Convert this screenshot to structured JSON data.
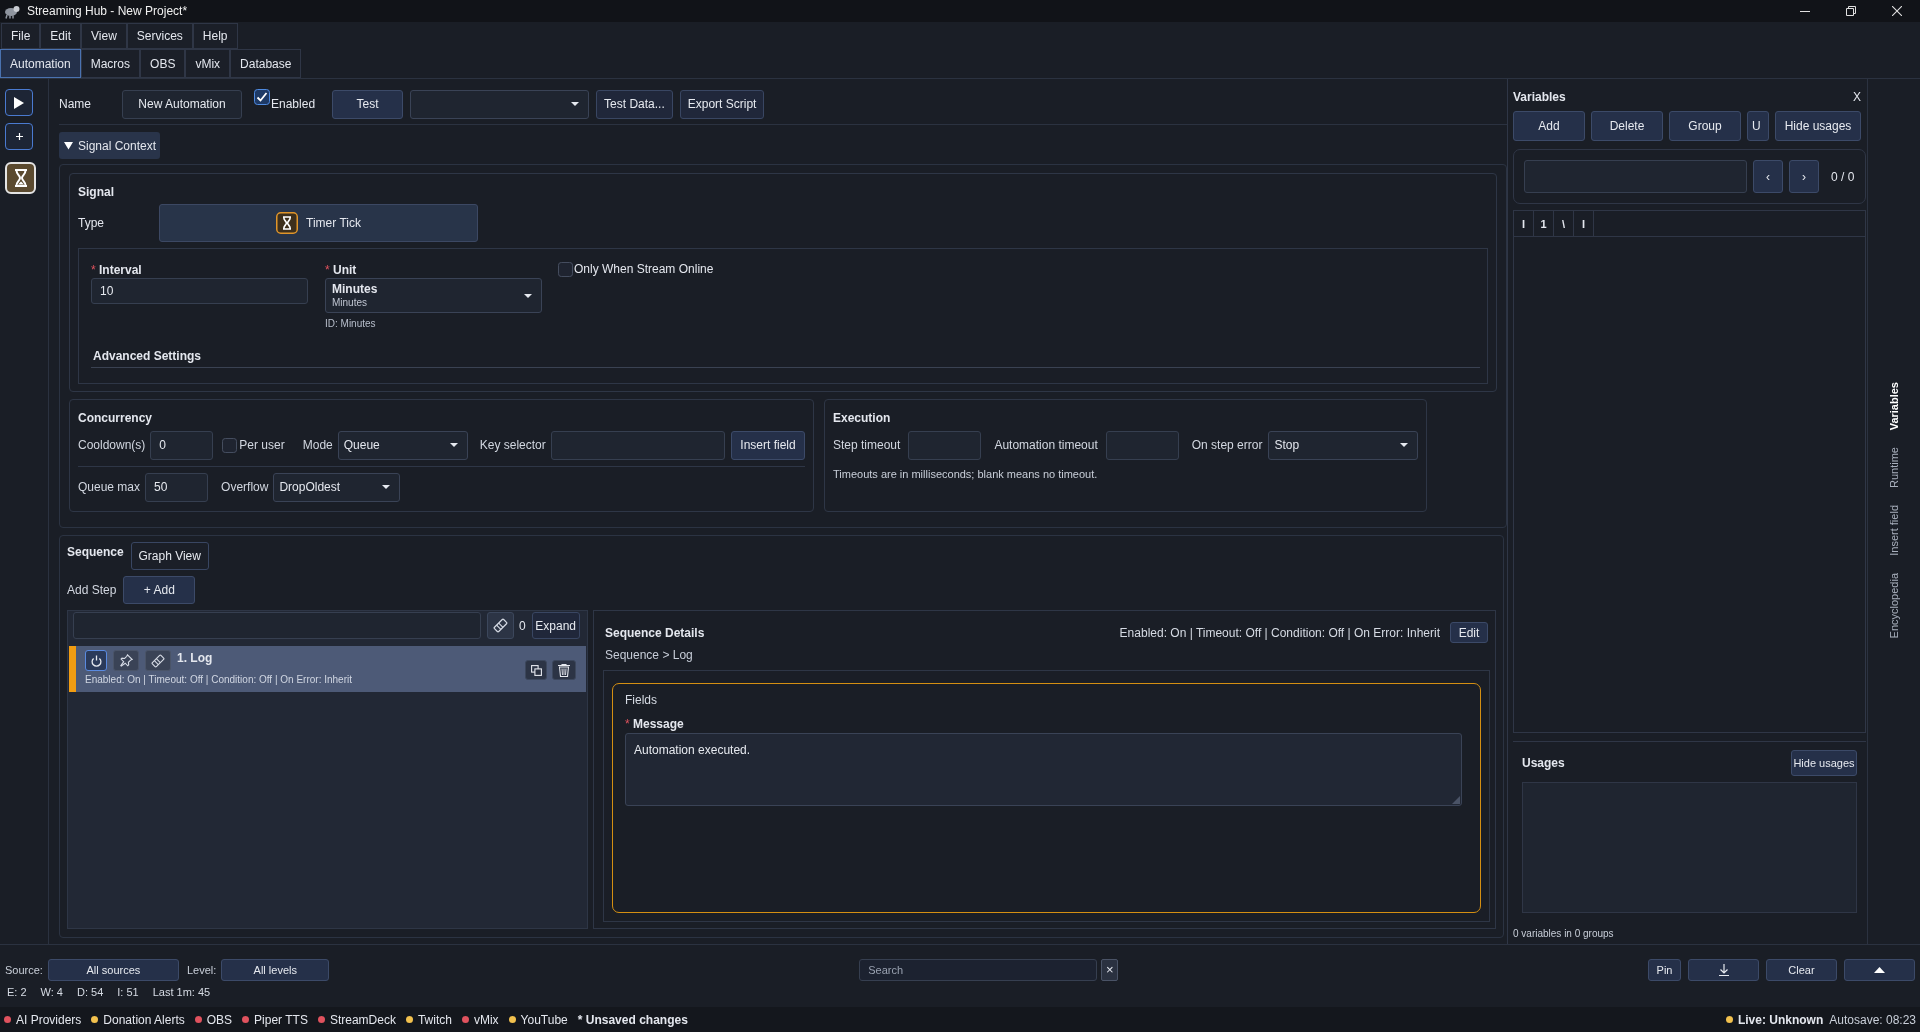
{
  "window": {
    "title": "Streaming Hub - New Project*"
  },
  "menu": [
    {
      "label": "File"
    },
    {
      "label": "Edit"
    },
    {
      "label": "View"
    },
    {
      "label": "Services"
    },
    {
      "label": "Help"
    }
  ],
  "tabs": [
    {
      "label": "Automation",
      "selected": true
    },
    {
      "label": "Macros",
      "selected": false
    },
    {
      "label": "OBS",
      "selected": false
    },
    {
      "label": "vMix",
      "selected": false
    },
    {
      "label": "Database",
      "selected": false
    }
  ],
  "side_toolbar": [
    {
      "kind": "play",
      "selected": false
    },
    {
      "kind": "add",
      "selected": false
    },
    {
      "kind": "timer",
      "selected": true
    }
  ],
  "toolbar": {
    "name_label": "Name",
    "name_value": "New Automation",
    "enabled_label": "Enabled",
    "enabled_checked": true,
    "test_button": "Test",
    "buttons": [
      {
        "label": "Test Data..."
      },
      {
        "label": "Export Script"
      }
    ]
  },
  "signal_context": {
    "label": "Signal Context",
    "expanded": true
  },
  "signal": {
    "title": "Signal",
    "type_label": "Type",
    "type_value": "Timer Tick",
    "interval": {
      "required_mark": "*",
      "label": "Interval",
      "value": "10"
    },
    "unit": {
      "required_mark": "*",
      "label": "Unit",
      "value": "Minutes",
      "detail": "Minutes",
      "id_note": "ID: Minutes"
    },
    "online_only": {
      "label": "Only When Stream Online",
      "checked": false
    },
    "advanced": "Advanced Settings"
  },
  "concurrency": {
    "title": "Concurrency",
    "cooldown_label": "Cooldown(s)",
    "cooldown": "0",
    "per_user": {
      "label": "Per user",
      "checked": false
    },
    "mode_label": "Mode",
    "mode": "Queue",
    "key_selector_label": "Key selector",
    "insert_field": "Insert field",
    "queue_max_label": "Queue max",
    "queue_max": "50",
    "overflow_label": "Overflow",
    "overflow": "DropOldest"
  },
  "execution": {
    "title": "Execution",
    "step_timeout_label": "Step timeout",
    "automation_timeout_label": "Automation timeout",
    "on_step_error_label": "On step error",
    "on_step_error": "Stop",
    "note": "Timeouts are in milliseconds; blank means no timeout."
  },
  "sequence": {
    "title": "Sequence",
    "graph_view": "Graph View",
    "add_step_label": "Add Step",
    "add_button": "+ Add",
    "step_count": "0",
    "expand": "Expand",
    "steps": [
      {
        "title": "1. Log",
        "summary": "Enabled: On | Timeout: Off | Condition: Off | On Error: Inherit",
        "selected": true,
        "enabled": true
      }
    ],
    "details": {
      "title": "Sequence Details",
      "summary": "Enabled: On | Timeout: Off | Condition: Off | On Error: Inherit",
      "edit": "Edit",
      "breadcrumb": "Sequence > Log",
      "fields_title": "Fields",
      "message": {
        "required_mark": "*",
        "label": "Message",
        "value": "Automation executed."
      }
    }
  },
  "variables": {
    "title": "Variables",
    "close": "X",
    "buttons": [
      {
        "label": "Add"
      },
      {
        "label": "Delete"
      },
      {
        "label": "Group"
      },
      {
        "label": "U"
      },
      {
        "label": "Hide usages"
      }
    ],
    "prev": "‹",
    "next": "›",
    "count": "0 / 0",
    "columns": [
      "I",
      "1",
      "\\",
      "I"
    ],
    "usages_title": "Usages",
    "usages_button": "Hide usages",
    "summary": "0 variables in 0 groups"
  },
  "side_tabs": [
    {
      "label": "Variables",
      "selected": true
    },
    {
      "label": "Runtime",
      "selected": false
    },
    {
      "label": "Insert field",
      "selected": false
    },
    {
      "label": "Encyclopedia",
      "selected": false
    }
  ],
  "log_bar": {
    "source_label": "Source:",
    "source": "All sources",
    "level_label": "Level:",
    "level": "All levels",
    "search_placeholder": "Search",
    "clear_search": "×",
    "pin": "Pin",
    "clear": "Clear",
    "stats": [
      "E: 2",
      "W: 4",
      "D: 54",
      "I: 51",
      "Last 1m: 45"
    ]
  },
  "status_bar": {
    "services": [
      {
        "name": "AI Providers",
        "color": "#e0525e"
      },
      {
        "name": "Donation Alerts",
        "color": "#f2c14e"
      },
      {
        "name": "OBS",
        "color": "#e0525e"
      },
      {
        "name": "Piper TTS",
        "color": "#e0525e"
      },
      {
        "name": "StreamDeck",
        "color": "#e0525e"
      },
      {
        "name": "Twitch",
        "color": "#f2c14e"
      },
      {
        "name": "vMix",
        "color": "#e0525e"
      },
      {
        "name": "YouTube",
        "color": "#f2c14e"
      }
    ],
    "unsaved": "* Unsaved changes",
    "live": {
      "label": "Live: Unknown",
      "color": "#f2c14e"
    },
    "autosave": "Autosave: 08:23"
  }
}
